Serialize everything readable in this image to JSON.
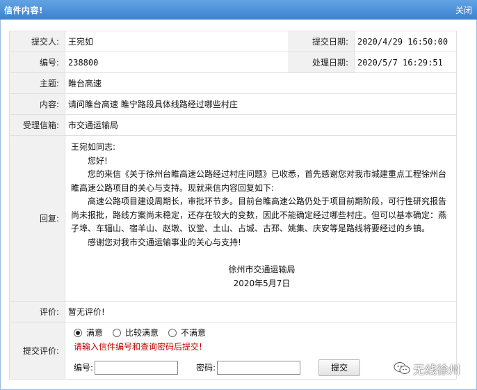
{
  "window": {
    "title": "信件内容!",
    "close_label": "关闭"
  },
  "fields": {
    "submitter_label": "提交人:",
    "submitter": "王宛如",
    "submit_date_label": "提交日期:",
    "submit_date": "2020/4/29 16:50:00",
    "number_label": "编号:",
    "number": "238800",
    "process_date_label": "处理日期:",
    "process_date": "2020/5/7 16:29:51",
    "subject_label": "主题:",
    "subject": "睢台高速",
    "content_label": "内容:",
    "content": "请问睢台高速 睢宁路段具体线路经过哪些村庄",
    "mailbox_label": "受理信箱:",
    "mailbox": "市交通运输局",
    "reply_label": "回复:",
    "evaluation_label": "评价:",
    "evaluation": "暂无评价!",
    "submit_eval_label": "提交评价:"
  },
  "reply": {
    "salutation": "王宛如同志:",
    "greeting": "您好!",
    "p1": "您的来信《关于徐州台睢高速公路经过村庄问题》已收悉，首先感谢您对我市城建重点工程徐州台睢高速公路项目的关心与支持。现就来信内容回复如下:",
    "p2": "高速公路项目建设周期长，审批环节多。目前台睢高速公路仍处于项目前期阶段，可行性研究报告尚未报批，路线方案尚未稳定，还存在较大的变数，因此不能确定经过哪些村庄。但可以基本确定：燕子埠、车辐山、宿羊山、赵墩、议堂、土山、占城、古邳、姚集、庆安等是路线将要经过的乡镇。",
    "p3": "感谢您对我市交通运输事业的关心与支持!",
    "signature": "徐州市交通运输局",
    "date": "2020年5月7日"
  },
  "rating": {
    "options": [
      "满意",
      "比较满意",
      "不满意"
    ],
    "selected": "满意",
    "warning": "请输入信件编号和查询密码后提交!",
    "number_label": "编号:",
    "password_label": "密码:",
    "number_value": "",
    "password_value": "",
    "submit_label": "提交"
  },
  "watermark": {
    "text": "无线徐州",
    "icon": "wechat-icon"
  }
}
